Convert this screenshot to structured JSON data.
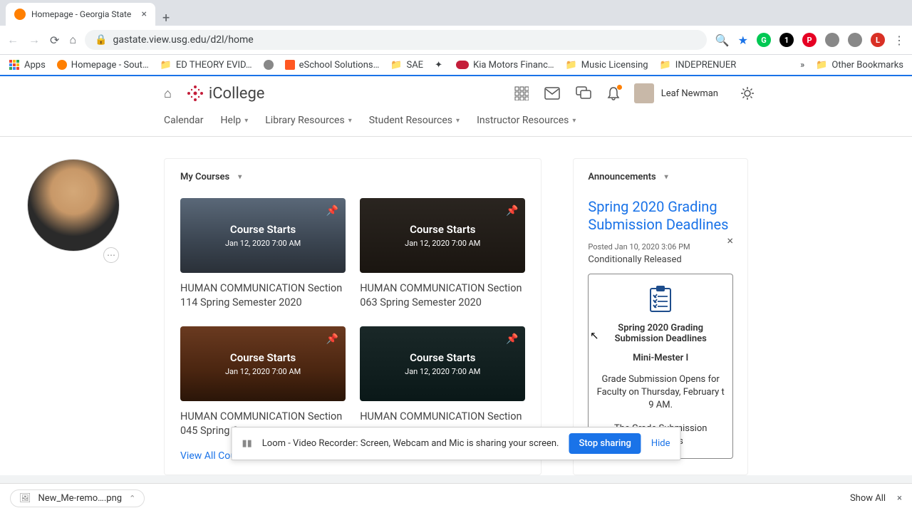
{
  "browser": {
    "tab_title": "Homepage - Georgia State",
    "url": "gastate.view.usg.edu/d2l/home"
  },
  "bookmarks": {
    "apps": "Apps",
    "items": [
      "Homepage - Sout…",
      "ED THEORY EVID…",
      "eSchool Solutions…",
      "SAE",
      "Kia Motors Financ…",
      "Music Licensing",
      "INDEPRENUER"
    ],
    "overflow": "»",
    "other": "Other Bookmarks"
  },
  "header": {
    "brand": "iCollege",
    "user_name": "Leaf Newman"
  },
  "nav": {
    "items": [
      "Calendar",
      "Help",
      "Library Resources",
      "Student Resources",
      "Instructor Resources"
    ]
  },
  "courses": {
    "heading": "My Courses",
    "starts_label": "Course Starts",
    "starts_date": "Jan 12, 2020 7:00 AM",
    "cards": [
      {
        "title": "HUMAN COMMUNICATION Section 114 Spring Semester 2020"
      },
      {
        "title": "HUMAN COMMUNICATION Section 063 Spring Semester 2020"
      },
      {
        "title": "HUMAN COMMUNICATION Section 045 Spring Semeste"
      },
      {
        "title": "HUMAN COMMUNICATION Section"
      }
    ],
    "view_all": "View All Courses"
  },
  "announcements": {
    "heading": "Announcements",
    "title": "Spring 2020 Grading Submission Deadlines",
    "posted": "Posted Jan 10, 2020 3:06 PM",
    "released": "Conditionally Released",
    "box_title": "Spring 2020 Grading Submission Deadlines",
    "subhead": "Mini-Mester I",
    "body1": "Grade Submission Opens for Faculty on Thursday, February         t 9 AM.",
    "body2": "The Grade Submission Deadline is"
  },
  "loom": {
    "msg": "Loom - Video Recorder: Screen, Webcam and Mic is sharing your screen.",
    "stop": "Stop sharing",
    "hide": "Hide"
  },
  "download": {
    "file": "New_Me-remo….png",
    "show_all": "Show All"
  }
}
